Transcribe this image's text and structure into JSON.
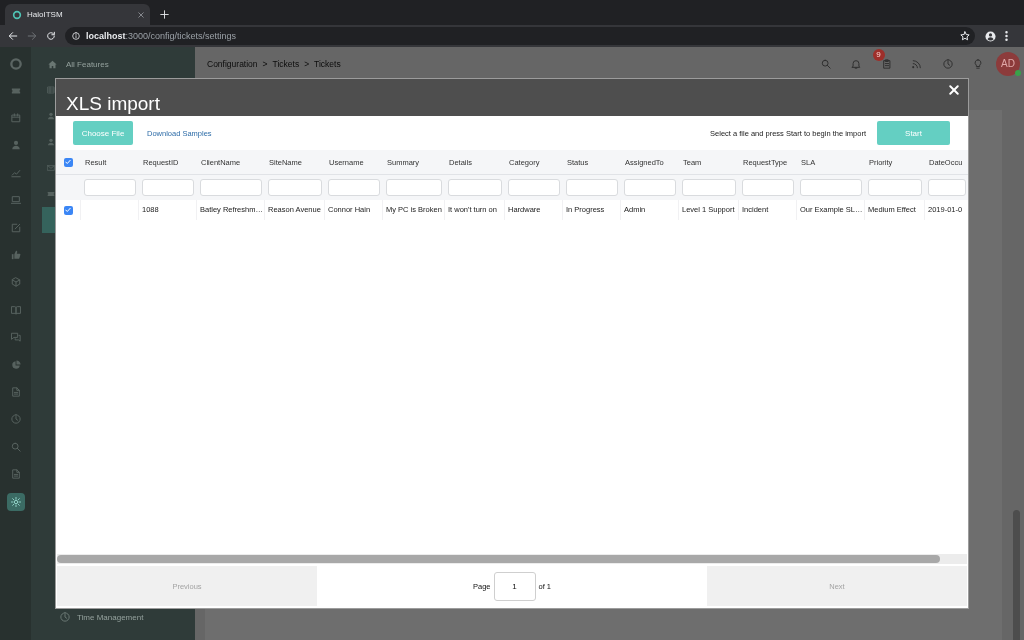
{
  "browser": {
    "tab_title": "HaloITSM",
    "url": "**localhost**:3000/config/tickets/settings"
  },
  "rail": [
    {
      "selected": false
    },
    {
      "selected": false
    },
    {
      "selected": false
    },
    {
      "selected": false
    },
    {
      "selected": false
    },
    {
      "selected": false
    },
    {
      "selected": false
    },
    {
      "selected": false
    },
    {
      "selected": false
    },
    {
      "selected": false
    },
    {
      "selected": false
    },
    {
      "selected": false
    },
    {
      "selected": false
    },
    {
      "selected": false
    },
    {
      "selected": false
    },
    {
      "selected": true
    }
  ],
  "sidebar": {
    "top_item": "All Features",
    "items": [
      {
        "selected": false
      },
      {
        "selected": false
      },
      {
        "selected": false
      },
      {
        "selected": false
      },
      {
        "selected": false
      },
      {
        "selected": true
      }
    ],
    "bottom_item": "Time Management"
  },
  "header": {
    "breadcrumb": [
      {
        "kind": "crumb",
        "text": "Configuration"
      },
      {
        "kind": "separator",
        "text": ">"
      },
      {
        "kind": "crumb",
        "text": "Tickets"
      },
      {
        "kind": "separator",
        "text": ">"
      },
      {
        "kind": "crumb",
        "text": "Tickets"
      }
    ],
    "notification_count": "9",
    "avatar": {
      "initials": "AD",
      "online": true
    }
  },
  "dialog": {
    "title": "XLS import",
    "choose_file": "Choose File",
    "download_link": "Download Samples",
    "hint": "Select a file and press Start to begin the import",
    "start_button": "Start",
    "table": {
      "all_selected": true,
      "columns": [
        "Result",
        "RequestID",
        "ClientName",
        "SiteName",
        "Username",
        "Summary",
        "Details",
        "Category",
        "Status",
        "AssignedTo",
        "Team",
        "RequestType",
        "SLA",
        "Priority",
        "DateOccu"
      ],
      "rows": [
        {
          "selected": true,
          "cells": [
            null,
            "1088",
            "Batley Refreshm…",
            "Reason Avenue",
            "Connor Hain",
            "My PC is Broken",
            "It won't turn on",
            "Hardware",
            "In Progress",
            "Admin",
            "Level 1 Support",
            "Incident",
            "Our Example SL…",
            "Medium Effect",
            "2019-01-0"
          ]
        }
      ]
    },
    "pagination": {
      "previous": {
        "label": "Previous",
        "disabled": true
      },
      "page_label": "Page",
      "page_value": "1",
      "total_label": "of 1",
      "next": {
        "label": "Next",
        "disabled": true
      }
    }
  }
}
